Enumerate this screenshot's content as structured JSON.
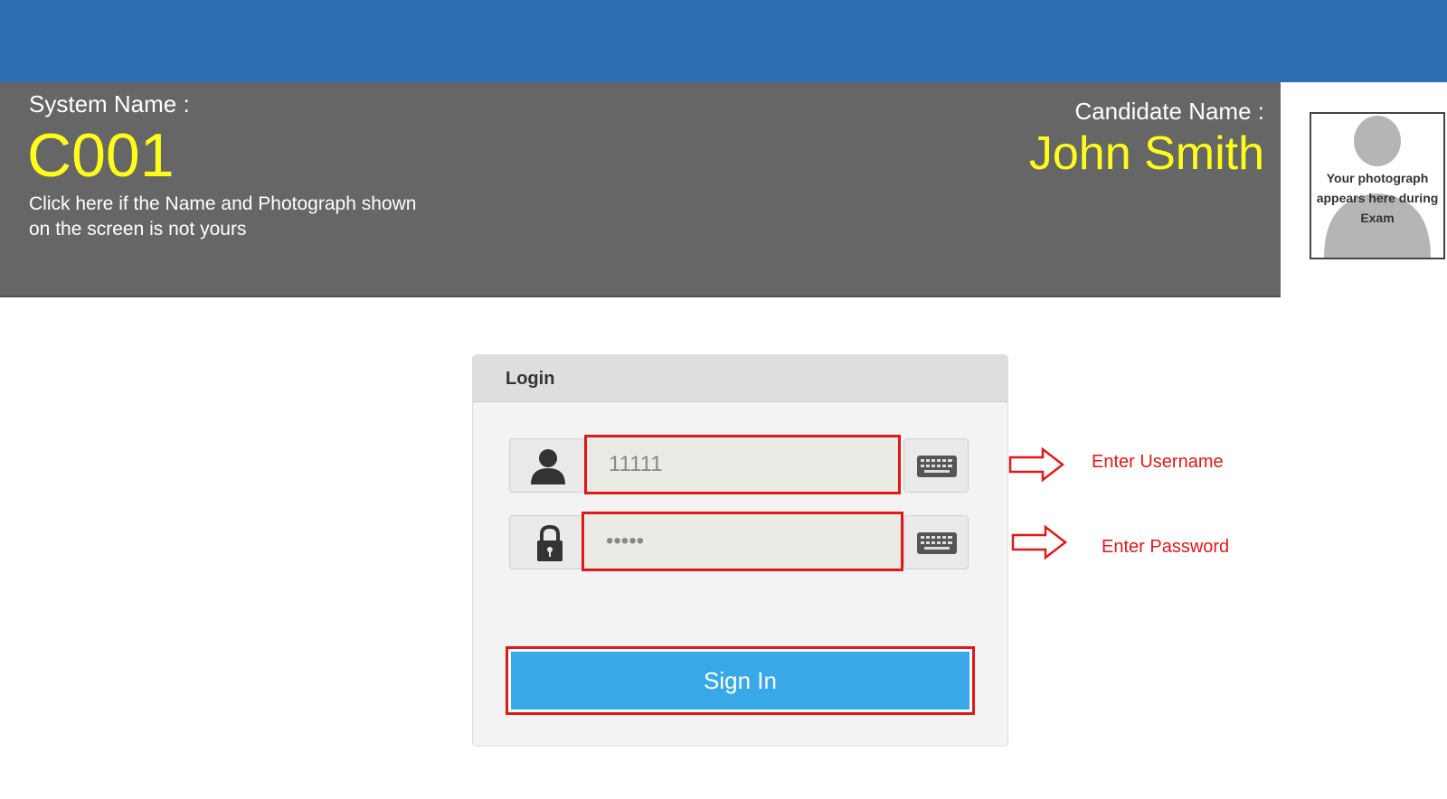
{
  "header": {
    "system_label": "System Name :",
    "system_value": "C001",
    "mismatch_link": "Click here if the Name and Photograph shown on the screen is not yours",
    "candidate_label": "Candidate Name :",
    "candidate_value": "John Smith",
    "photo_text": "Your photograph appears here during Exam"
  },
  "login": {
    "title": "Login",
    "username": {
      "value": "11111",
      "icon": "user-icon"
    },
    "password": {
      "value": "*****",
      "icon": "lock-icon"
    },
    "keyboard_icon": "keyboard-icon",
    "signin_label": "Sign In"
  },
  "annotations": {
    "username_hint": "Enter Username",
    "password_hint": "Enter Password"
  },
  "colors": {
    "top_bar": "#2d6fb5",
    "header_band": "#666666",
    "highlight_text": "#ffff1a",
    "annotation_red": "#e01818",
    "signin_blue": "#38a9e6"
  }
}
